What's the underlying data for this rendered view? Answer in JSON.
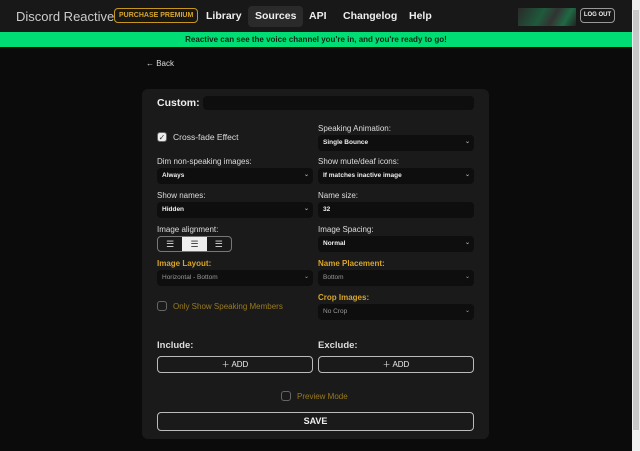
{
  "nav": {
    "brand": "Discord Reactive",
    "premium": "PURCHASE PREMIUM",
    "links": [
      "Library",
      "Sources",
      "API",
      "Changelog",
      "Help"
    ],
    "active": "Sources",
    "logout": "LOG OUT"
  },
  "status": "Reactive can see the voice channel you're in, and you're ready to go!",
  "back": "← Back",
  "form": {
    "custom_label": "Custom:",
    "custom_value": "",
    "crossfade": {
      "label": "Cross-fade Effect",
      "checked": true
    },
    "speaking_animation": {
      "label": "Speaking Animation:",
      "value": "Single Bounce"
    },
    "dim": {
      "label": "Dim non-speaking images:",
      "value": "Always"
    },
    "mute_icons": {
      "label": "Show mute/deaf icons:",
      "value": "If matches inactive image"
    },
    "show_names": {
      "label": "Show names:",
      "value": "Hidden"
    },
    "name_size": {
      "label": "Name size:",
      "value": "32"
    },
    "image_alignment": {
      "label": "Image alignment:",
      "selected": "center"
    },
    "image_spacing": {
      "label": "Image Spacing:",
      "value": "Normal"
    },
    "image_layout": {
      "label": "Image Layout:",
      "value": "Horizontal - Bottom"
    },
    "name_placement": {
      "label": "Name Placement:",
      "value": "Bottom"
    },
    "only_speaking": {
      "label": "Only Show Speaking Members",
      "checked": false
    },
    "crop_images": {
      "label": "Crop Images:",
      "value": "No Crop"
    },
    "include": {
      "label": "Include:",
      "button": "ADD"
    },
    "exclude": {
      "label": "Exclude:",
      "button": "ADD"
    },
    "preview_mode": {
      "label": "Preview Mode",
      "checked": false
    },
    "save": "SAVE"
  },
  "colors": {
    "accent": "#00dd74",
    "gold": "#d8a52a"
  }
}
